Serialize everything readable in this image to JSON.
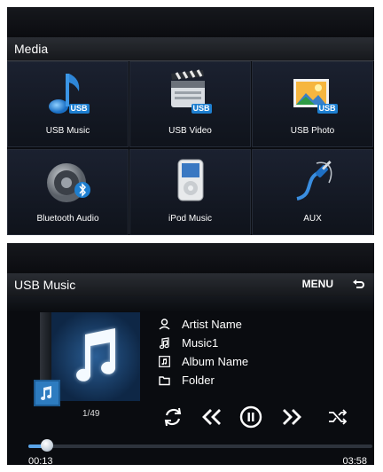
{
  "media": {
    "title": "Media",
    "items": [
      {
        "label": "USB Music",
        "icon": "usb-music-icon"
      },
      {
        "label": "USB Video",
        "icon": "usb-video-icon"
      },
      {
        "label": "USB Photo",
        "icon": "usb-photo-icon"
      },
      {
        "label": "Bluetooth Audio",
        "icon": "bluetooth-audio-icon"
      },
      {
        "label": "iPod Music",
        "icon": "ipod-icon"
      },
      {
        "label": "AUX",
        "icon": "aux-cable-icon"
      }
    ],
    "usb_badge": "USB"
  },
  "player": {
    "title": "USB Music",
    "menu_label": "MENU",
    "artist": "Artist Name",
    "song": "Music1",
    "album": "Album Name",
    "folder": "Folder",
    "track_count": "1/49",
    "elapsed": "00:13",
    "duration": "03:58",
    "progress": 0.055
  },
  "colors": {
    "accent": "#1e7fd0",
    "background": "#0a0c10",
    "tile": "#151a24"
  }
}
